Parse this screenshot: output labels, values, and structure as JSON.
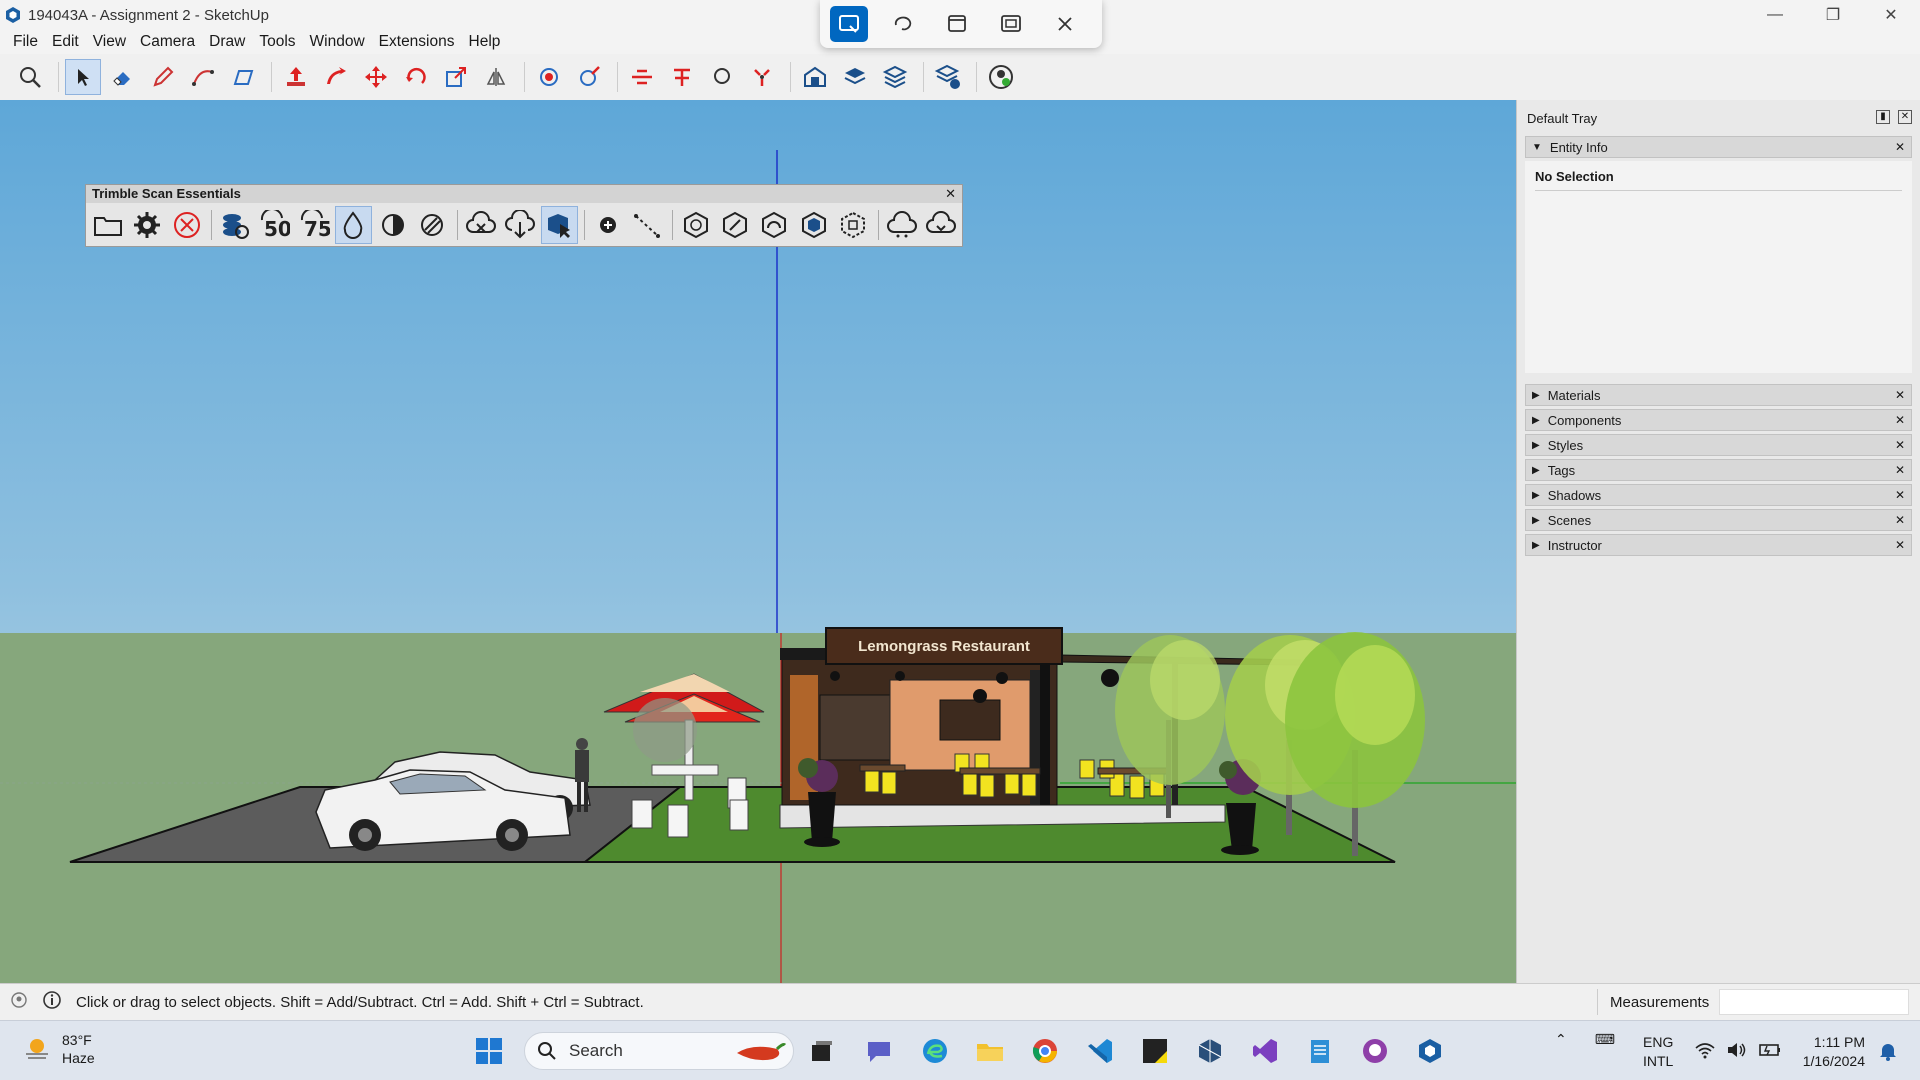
{
  "window": {
    "title": "194043A - Assignment 2 - SketchUp"
  },
  "menu": [
    "File",
    "Edit",
    "View",
    "Camera",
    "Draw",
    "Tools",
    "Window",
    "Extensions",
    "Help"
  ],
  "scan_panel": {
    "title": "Trimble Scan Essentials",
    "icons": [
      "open-folder-icon",
      "settings-gear-icon",
      "cancel-icon",
      "point-cloud-icon",
      "50-percent-icon",
      "75-percent-icon",
      "drop-icon",
      "contrast-icon",
      "hatch-icon",
      "cloud-x-icon",
      "cloud-download-icon",
      "cube-cursor-icon",
      "add-point-icon",
      "line-icon",
      "iso-1-icon",
      "iso-2-icon",
      "iso-3-icon",
      "iso-4-icon",
      "iso-5-icon",
      "cloud-1-icon",
      "cloud-2-icon"
    ]
  },
  "model": {
    "sign_text": "Lemongrass Restaurant"
  },
  "tray": {
    "title": "Default Tray",
    "entity_info": {
      "label": "Entity Info",
      "selection": "No Selection"
    },
    "panels": [
      "Materials",
      "Components",
      "Styles",
      "Tags",
      "Shadows",
      "Scenes",
      "Instructor"
    ]
  },
  "status": {
    "hint": "Click or drag to select objects. Shift = Add/Subtract. Ctrl = Add. Shift + Ctrl = Subtract.",
    "measurements_label": "Measurements"
  },
  "taskbar": {
    "weather_temp": "83°F",
    "weather_desc": "Haze",
    "search_label": "Search",
    "lang_1": "ENG",
    "lang_2": "INTL",
    "time": "1:11 PM",
    "date": "1/16/2024"
  },
  "colors": {
    "sky_top": "#5ea7d8",
    "ground": "#86a77c",
    "accent_blue": "#0067c0"
  }
}
